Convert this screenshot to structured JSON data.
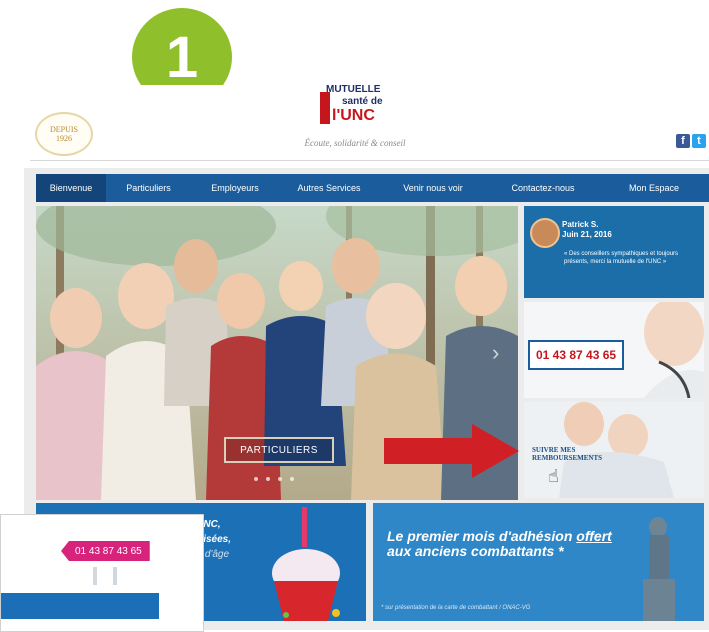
{
  "step": {
    "number": "1"
  },
  "header": {
    "since_line1": "DEPUIS",
    "since_line2": "1926",
    "logo_line1": "MUTUELLE",
    "logo_line2": "santé de",
    "logo_line3": "l'UNC",
    "tagline": "Écoute, solidarité & conseil",
    "social": [
      "f",
      "t"
    ]
  },
  "nav": {
    "items": [
      {
        "label": "Bienvenue",
        "active": true
      },
      {
        "label": "Particuliers",
        "active": false
      },
      {
        "label": "Employeurs",
        "active": false
      },
      {
        "label": "Autres Services",
        "active": false
      },
      {
        "label": "Venir nous voir",
        "active": false
      },
      {
        "label": "Contactez-nous",
        "active": false
      },
      {
        "label": "Mon Espace",
        "active": false
      }
    ]
  },
  "hero": {
    "cta_label": "PARTICULIERS",
    "slide_count": 4,
    "next_icon": "chevron-right-icon"
  },
  "testimonial": {
    "name": "Patrick S.",
    "date": "Juin 21, 2016",
    "quote": "« Des conseillers sympathiques et toujours présents, merci la mutuelle de l'UNC »"
  },
  "phone_box": {
    "number": "01 43 87 43 65"
  },
  "reimbursement": {
    "label": "SUIVRE MES REMBOURSEMENTS",
    "cursor_icon": "hand-pointer-icon"
  },
  "banner_left": {
    "line1": "l'UNC,",
    "line2": "tolisées,",
    "line3": "he d'âge"
  },
  "banner_right": {
    "title_pre": "Le premier mois d'adhésion ",
    "title_underlined": "offert",
    "title_line2": "aux anciens combattants *",
    "footnote": "* sur présentation de la carte de combattant / ONAC-VG"
  },
  "zoom_card": {
    "phone_tag": "01 43 87 43 65"
  },
  "colors": {
    "nav": "#1b5d9c",
    "badge": "#8fbf2a",
    "accent_red": "#d11f26",
    "pink_tag": "#d8237c"
  }
}
